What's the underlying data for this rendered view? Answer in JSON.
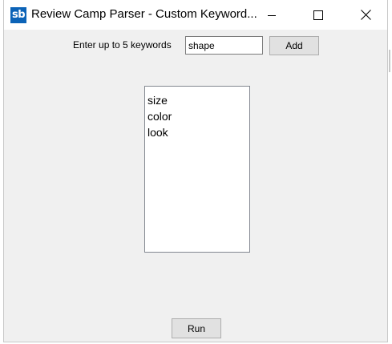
{
  "window": {
    "title": "Review Camp Parser - Custom Keyword...",
    "app_icon_text": "sb",
    "controls": {
      "minimize_icon": "minimize-icon",
      "maximize_icon": "maximize-icon",
      "close_icon": "close-icon"
    }
  },
  "form": {
    "keyword_label": "Enter up to 5 keywords",
    "keyword_input_value": "shape",
    "add_label": "Add",
    "keywords": [
      "size",
      "color",
      "look"
    ],
    "run_label": "Run"
  },
  "colors": {
    "app_icon_bg": "#0c63b7",
    "window_bg": "#f0f0f0",
    "button_bg": "#e1e1e1"
  }
}
